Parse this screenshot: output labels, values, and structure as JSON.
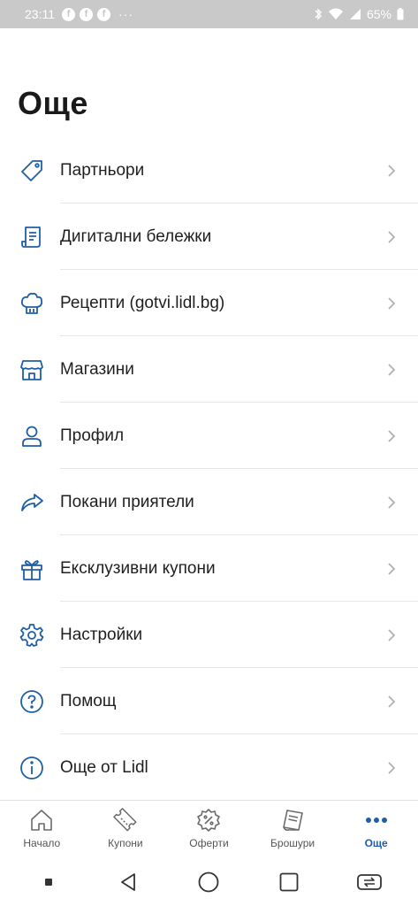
{
  "status_bar": {
    "time": "23:11",
    "notifications": [
      "facebook-icon",
      "facebook-icon",
      "facebook-icon"
    ],
    "more": "···",
    "battery": "65%"
  },
  "page": {
    "title": "Още"
  },
  "menu": {
    "items": [
      {
        "label": "Партньори",
        "icon": "tag-icon"
      },
      {
        "label": "Дигитални бележки",
        "icon": "receipt-icon"
      },
      {
        "label": "Рецепти (gotvi.lidl.bg)",
        "icon": "chef-hat-icon"
      },
      {
        "label": "Магазини",
        "icon": "store-icon"
      },
      {
        "label": "Профил",
        "icon": "user-icon"
      },
      {
        "label": "Покани приятели",
        "icon": "share-icon"
      },
      {
        "label": "Ексклузивни купони",
        "icon": "gift-icon"
      },
      {
        "label": "Настройки",
        "icon": "gear-icon"
      },
      {
        "label": "Помощ",
        "icon": "help-icon"
      },
      {
        "label": "Още от Lidl",
        "icon": "info-icon"
      }
    ]
  },
  "tabbar": {
    "tabs": [
      {
        "label": "Начало",
        "icon": "home-icon",
        "active": false
      },
      {
        "label": "Купони",
        "icon": "coupon-icon",
        "active": false
      },
      {
        "label": "Оферти",
        "icon": "offer-badge-icon",
        "active": false
      },
      {
        "label": "Брошури",
        "icon": "brochure-icon",
        "active": false
      },
      {
        "label": "Още",
        "icon": "more-dots-icon",
        "active": true
      }
    ]
  },
  "colors": {
    "accent": "#1f5fa8",
    "text": "#1f1f1f",
    "divider": "#e6e6e6",
    "chevron": "#b0b0b0",
    "status_bar": "#c9c9c9"
  }
}
